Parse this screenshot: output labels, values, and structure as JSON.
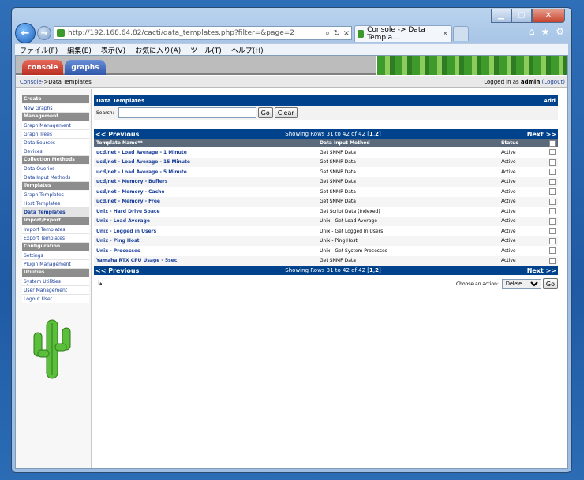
{
  "browser": {
    "url": "http://192.168.64.82/cacti/data_templates.php?filter=&page=2",
    "tab_title": "Console -> Data Templa...",
    "tab_close": "×",
    "menu": [
      "ファイル(F)",
      "編集(E)",
      "表示(V)",
      "お気に入り(A)",
      "ツール(T)",
      "ヘルプ(H)"
    ]
  },
  "app": {
    "tab_console": "console",
    "tab_graphs": "graphs",
    "breadcrumb_home": "Console",
    "breadcrumb_sep": " -> ",
    "breadcrumb_current": "Data Templates",
    "logged_prefix": "Logged in as ",
    "logged_user": "admin",
    "logout": "(Logout)"
  },
  "sidebar": {
    "sections": [
      {
        "header": "Create",
        "items": [
          "New Graphs"
        ]
      },
      {
        "header": "Management",
        "items": [
          "Graph Management",
          "Graph Trees",
          "Data Sources",
          "Devices"
        ]
      },
      {
        "header": "Collection Methods",
        "items": [
          "Data Queries",
          "Data Input Methods"
        ]
      },
      {
        "header": "Templates",
        "items": [
          "Graph Templates",
          "Host Templates",
          "Data Templates"
        ]
      },
      {
        "header": "Import/Export",
        "items": [
          "Import Templates",
          "Export Templates"
        ]
      },
      {
        "header": "Configuration",
        "items": [
          "Settings",
          "Plugin Management"
        ]
      },
      {
        "header": "Utilities",
        "items": [
          "System Utilities",
          "User Management",
          "Logout User"
        ]
      }
    ],
    "selected": "Data Templates"
  },
  "main": {
    "title": "Data Templates",
    "add": "Add",
    "search_label": "Search:",
    "search_value": "",
    "go": "Go",
    "clear": "Clear",
    "prev": "<< Previous",
    "next": "Next >>",
    "showing": "Showing Rows 31 to 42 of 42 [",
    "page1": "1",
    "page_sep": ",",
    "page2": "2",
    "showing_end": "]",
    "col_name": "Template Name**",
    "col_method": "Data Input Method",
    "col_status": "Status",
    "rows": [
      {
        "name": "ucd/net - Load Average - 1 Minute",
        "method": "Get SNMP Data",
        "status": "Active"
      },
      {
        "name": "ucd/net - Load Average - 15 Minute",
        "method": "Get SNMP Data",
        "status": "Active"
      },
      {
        "name": "ucd/net - Load Average - 5 Minute",
        "method": "Get SNMP Data",
        "status": "Active"
      },
      {
        "name": "ucd/net - Memory - Buffers",
        "method": "Get SNMP Data",
        "status": "Active"
      },
      {
        "name": "ucd/net - Memory - Cache",
        "method": "Get SNMP Data",
        "status": "Active"
      },
      {
        "name": "ucd/net - Memory - Free",
        "method": "Get SNMP Data",
        "status": "Active"
      },
      {
        "name": "Unix - Hard Drive Space",
        "method": "Get Script Data (Indexed)",
        "status": "Active"
      },
      {
        "name": "Unix - Load Average",
        "method": "Unix - Get Load Average",
        "status": "Active"
      },
      {
        "name": "Unix - Logged in Users",
        "method": "Unix - Get Logged In Users",
        "status": "Active"
      },
      {
        "name": "Unix - Ping Host",
        "method": "Unix - Ping Host",
        "status": "Active"
      },
      {
        "name": "Unix - Processes",
        "method": "Unix - Get System Processes",
        "status": "Active"
      },
      {
        "name": "Yamaha RTX CPU Usage - 5sec",
        "method": "Get SNMP Data",
        "status": "Active"
      }
    ],
    "action_label": "Choose an action:",
    "action_value": "Delete",
    "action_go": "Go"
  }
}
